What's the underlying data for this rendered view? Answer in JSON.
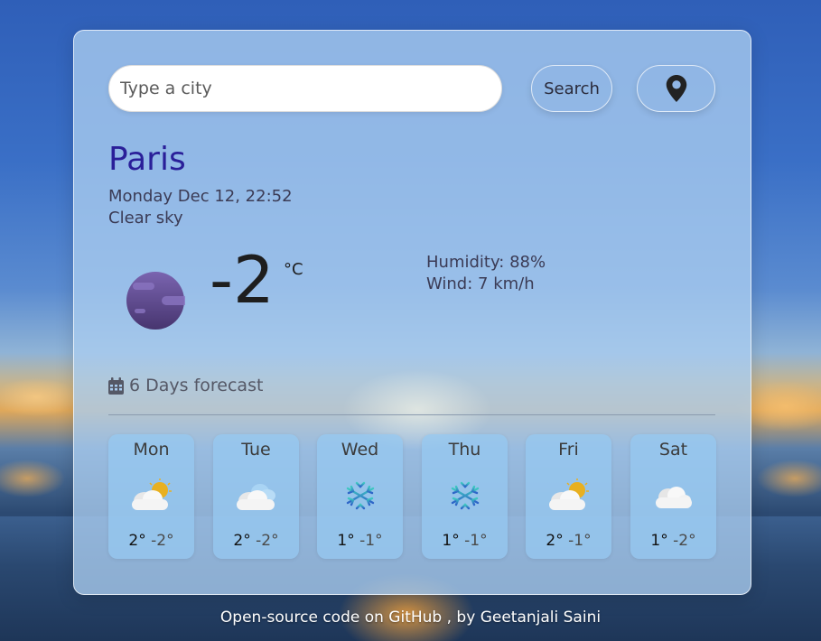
{
  "search": {
    "placeholder": "Type a city",
    "value": "",
    "button_label": "Search",
    "location_icon": "map-marker-icon"
  },
  "current": {
    "city": "Paris",
    "datetime": "Monday Dec 12, 22:52",
    "description": "Clear sky",
    "icon": "night-moon-icon",
    "temperature": "-2",
    "unit": "°C",
    "humidity": "Humidity: 88%",
    "wind": "Wind: 7 km/h"
  },
  "forecast": {
    "title": "6 Days forecast",
    "title_icon": "calendar-icon",
    "days": [
      {
        "day": "Mon",
        "icon": "partly-cloudy-icon",
        "max": "2°",
        "min": "-2°"
      },
      {
        "day": "Tue",
        "icon": "cloudy-icon",
        "max": "2°",
        "min": "-2°"
      },
      {
        "day": "Wed",
        "icon": "snowflake-icon",
        "max": "1°",
        "min": "-1°"
      },
      {
        "day": "Thu",
        "icon": "snowflake-icon",
        "max": "1°",
        "min": "-1°"
      },
      {
        "day": "Fri",
        "icon": "partly-cloudy-icon",
        "max": "2°",
        "min": "-1°"
      },
      {
        "day": "Sat",
        "icon": "cloud-icon",
        "max": "1°",
        "min": "-2°"
      }
    ]
  },
  "footer": {
    "link_label": "Open-source code",
    "middle": " on GitHub , by ",
    "author": "Geetanjali Saini"
  },
  "colors": {
    "city": "#2a1f99",
    "card_bg": "#aacdf0",
    "forecast_card_bg": "#96c8f0",
    "moon": "#5b4a8c"
  }
}
